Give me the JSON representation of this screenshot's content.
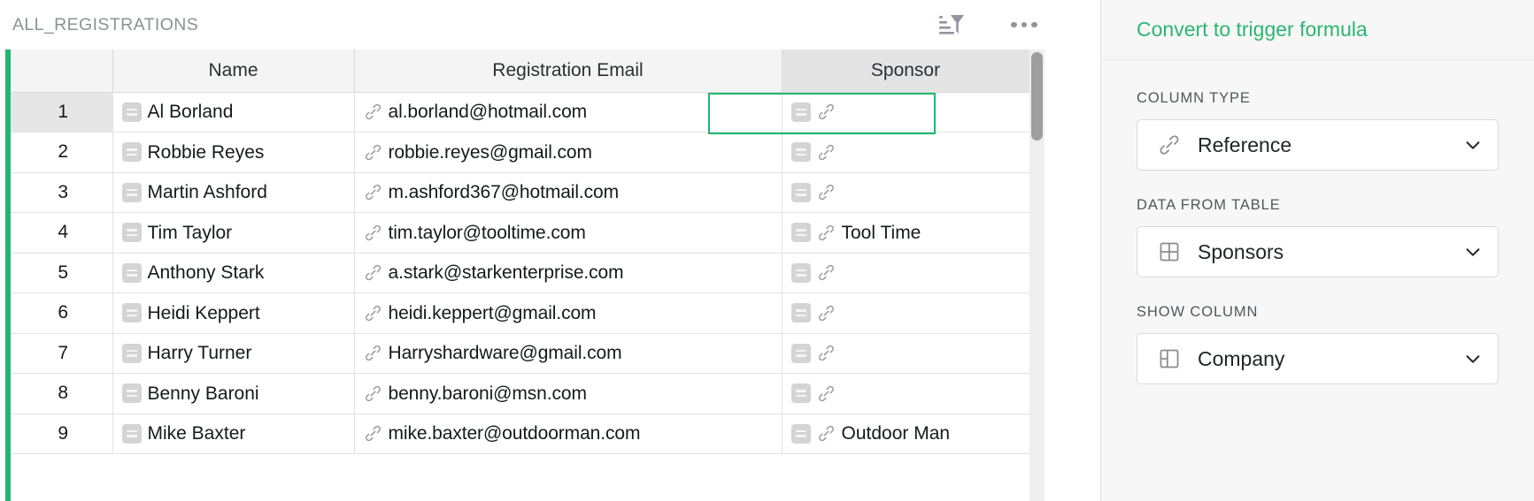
{
  "table": {
    "title": "ALL_REGISTRATIONS",
    "header_actions": [
      {
        "name": "sort-filter-icon",
        "label": "Sort and filter"
      },
      {
        "name": "more-options-icon",
        "label": "More options"
      }
    ],
    "columns": [
      {
        "key": "num",
        "label": ""
      },
      {
        "key": "name",
        "label": "Name"
      },
      {
        "key": "email",
        "label": "Registration Email"
      },
      {
        "key": "sponsor",
        "label": "Sponsor"
      }
    ],
    "selected_column": "Sponsor",
    "selected_cell": {
      "row": 1,
      "column": "Sponsor"
    },
    "rows": [
      {
        "num": "1",
        "name": "Al Borland",
        "email": "al.borland@hotmail.com",
        "sponsor": ""
      },
      {
        "num": "2",
        "name": "Robbie Reyes",
        "email": "robbie.reyes@gmail.com",
        "sponsor": ""
      },
      {
        "num": "3",
        "name": "Martin Ashford",
        "email": "m.ashford367@hotmail.com",
        "sponsor": ""
      },
      {
        "num": "4",
        "name": "Tim Taylor",
        "email": "tim.taylor@tooltime.com",
        "sponsor": "Tool Time"
      },
      {
        "num": "5",
        "name": "Anthony Stark",
        "email": "a.stark@starkenterprise.com",
        "sponsor": ""
      },
      {
        "num": "6",
        "name": "Heidi Keppert",
        "email": "heidi.keppert@gmail.com",
        "sponsor": ""
      },
      {
        "num": "7",
        "name": "Harry Turner",
        "email": "Harryshardware@gmail.com",
        "sponsor": ""
      },
      {
        "num": "8",
        "name": "Benny Baroni",
        "email": "benny.baroni@msn.com",
        "sponsor": ""
      },
      {
        "num": "9",
        "name": "Mike Baxter",
        "email": "mike.baxter@outdoorman.com",
        "sponsor": "Outdoor Man"
      }
    ]
  },
  "inspector": {
    "convert_link": "Convert to trigger formula",
    "fields": [
      {
        "label": "COLUMN TYPE",
        "value": "Reference",
        "icon": "link-icon",
        "caret": "chevron-down-icon"
      },
      {
        "label": "DATA FROM TABLE",
        "value": "Sponsors",
        "icon": "table-grid-icon",
        "caret": "chevron-down-icon"
      },
      {
        "label": "SHOW COLUMN",
        "value": "Company",
        "icon": "column-icon",
        "caret": "chevron-down-icon"
      }
    ]
  },
  "colors": {
    "accent_green": "#21b573",
    "link_green": "#2cb673",
    "selection_green": "#1db96f",
    "title_gray": "#8b9196",
    "icon_gray": "#9195a0"
  }
}
